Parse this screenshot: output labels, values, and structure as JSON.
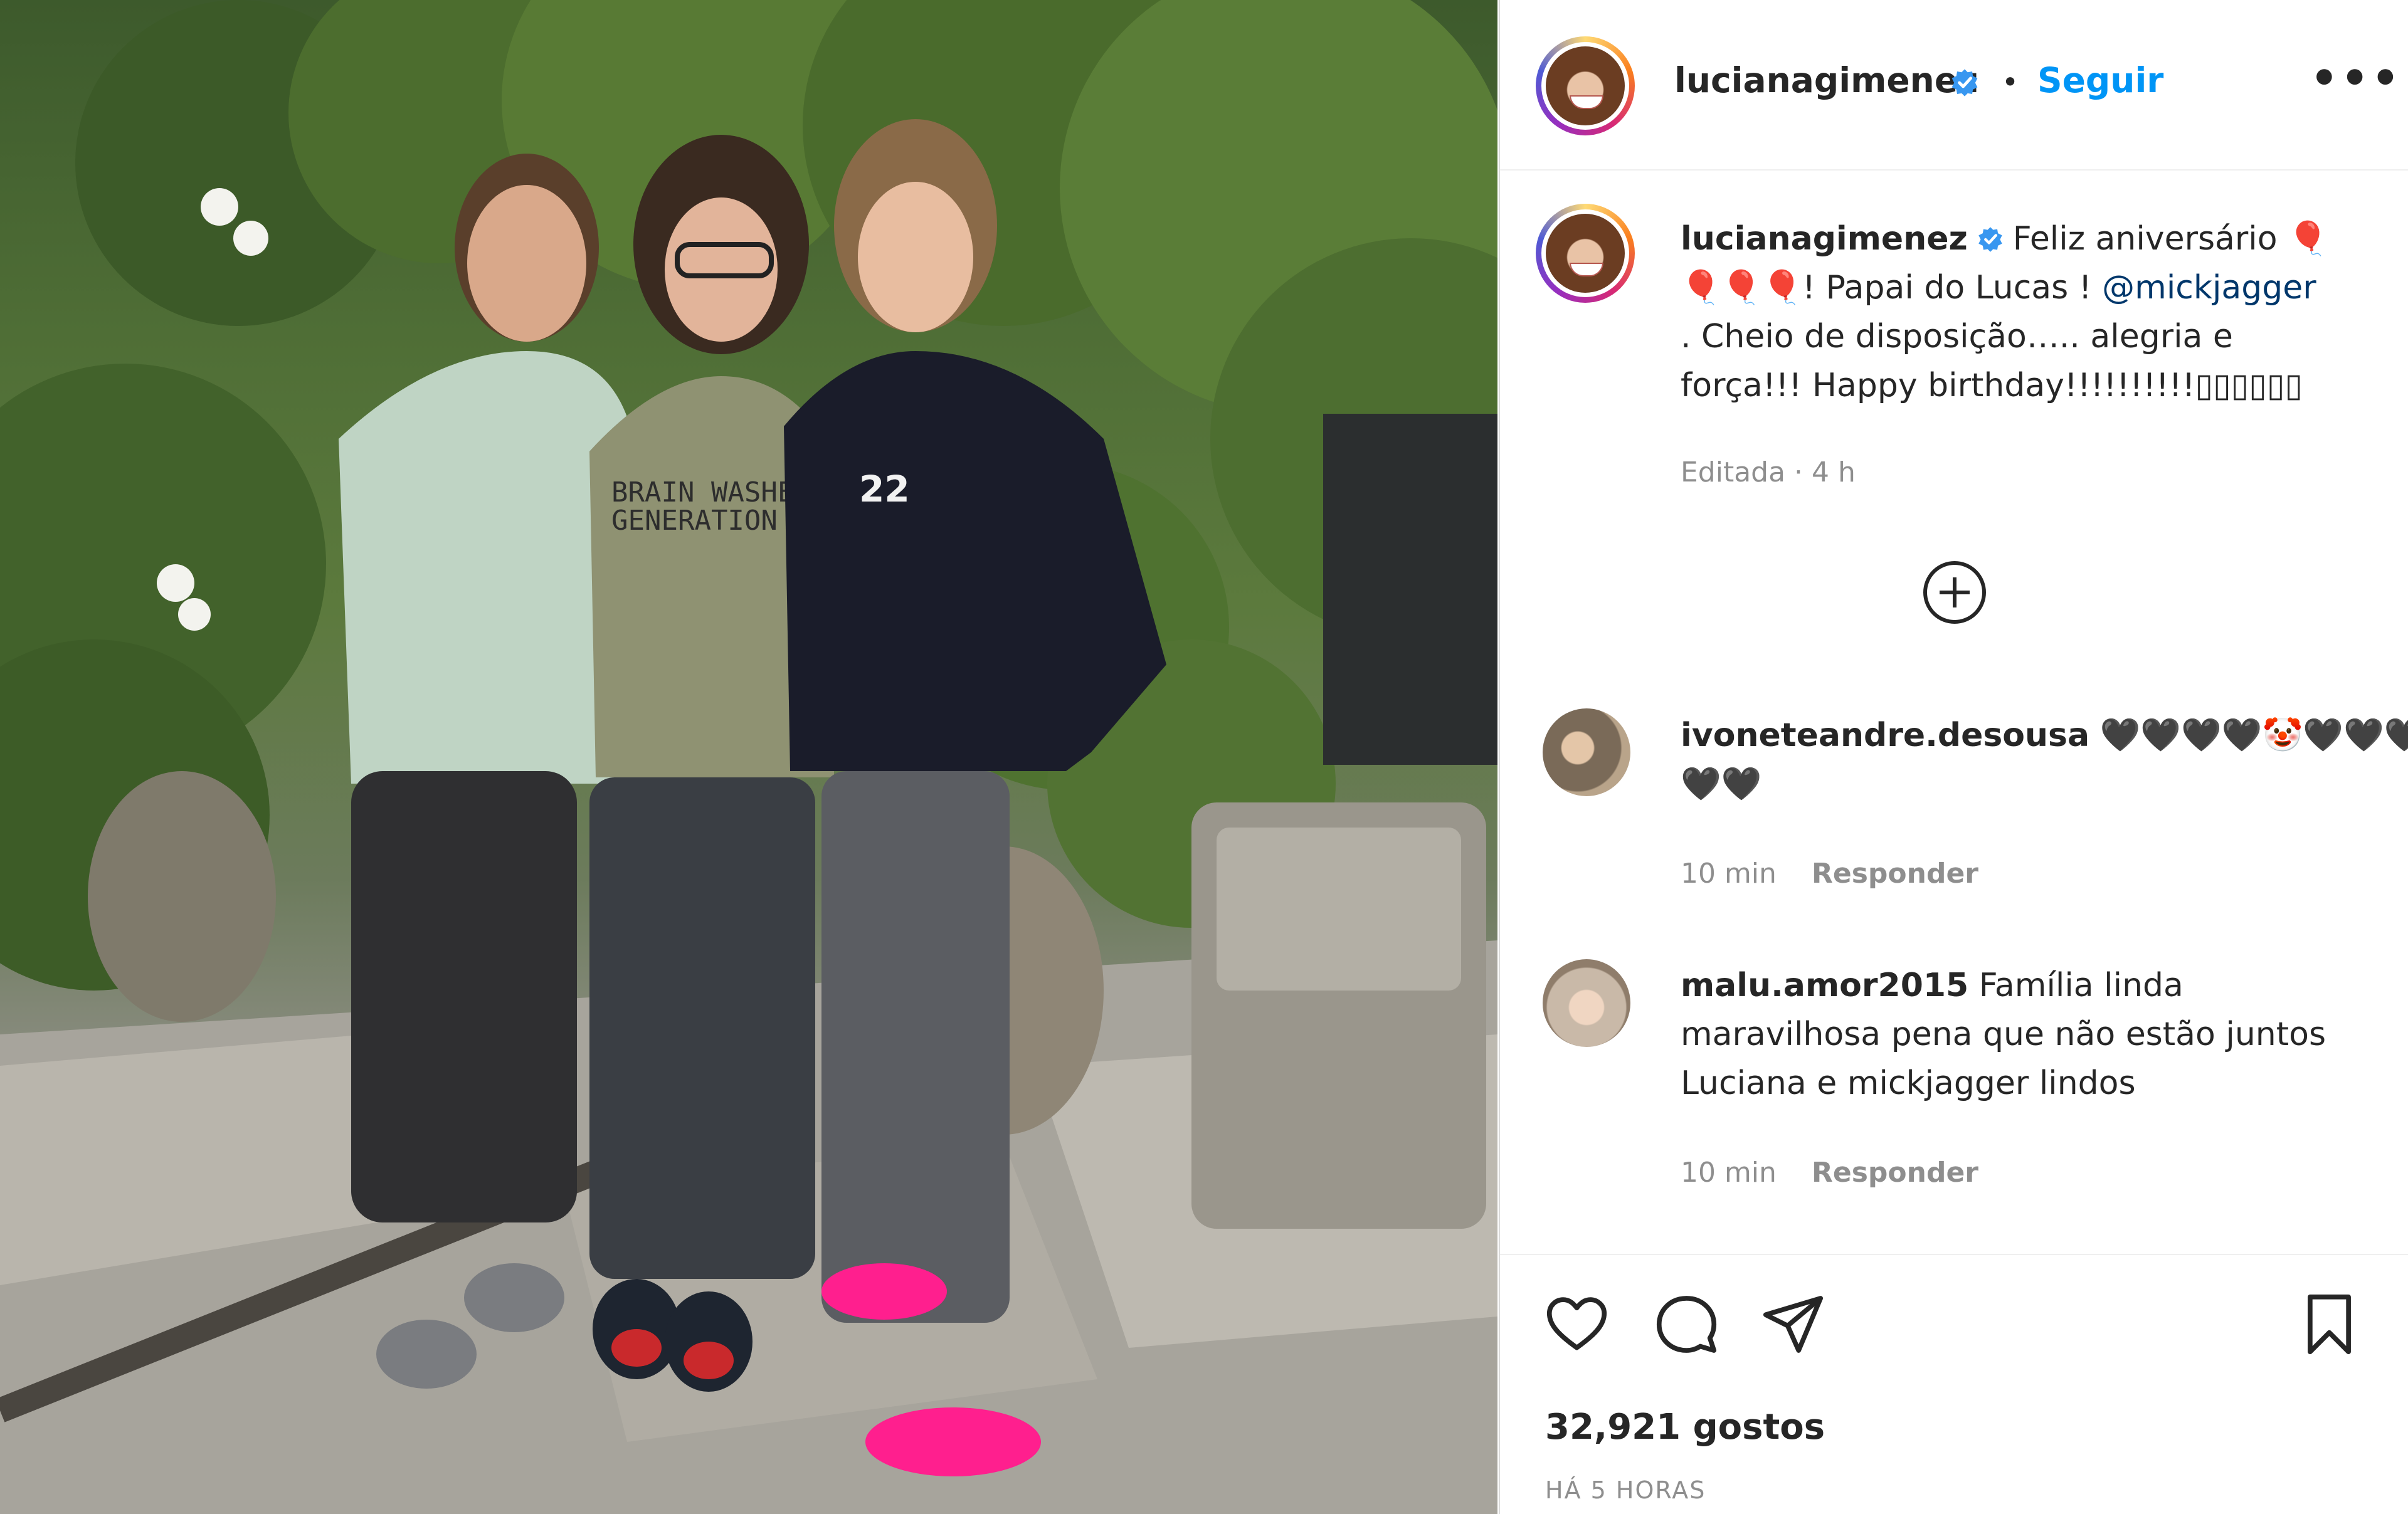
{
  "post": {
    "username": "lucianagimenez",
    "follow_label": "Seguir",
    "separator": "•",
    "more_label": "•••",
    "caption": {
      "username": "lucianagimenez",
      "line1": "Feliz aniversário 🎈",
      "line2a": "🎈🎈🎈! Papai do Lucas ! ",
      "mention": "@mickjagger",
      "line3": ". Cheio de disposição….. alegria e",
      "line4": "força!!! Happy birthday!!!!!!!!!!▯▯▯▯▯▯",
      "meta": "Editada · 4 h"
    },
    "comments": [
      {
        "username": "ivoneteandre.desousa",
        "text_line1": "🖤🖤🖤🖤🤡🖤🖤🖤",
        "text_line2": "🖤🖤",
        "time": "10 min",
        "reply_label": "Responder"
      },
      {
        "username": "malu.amor2015",
        "text_line1": "Família linda",
        "text_line2": "maravilhosa pena que não estão juntos",
        "text_line3": "Luciana e mickjagger lindos",
        "time": "10 min",
        "reply_label": "Responder"
      }
    ],
    "likes_text": "32,921 gostos",
    "posted_ago": "HÁ 5 HORAS"
  },
  "photo": {
    "shirt_text_line1": "BRAIN WASHED",
    "shirt_text_line2": "GENERATION",
    "hoodie_text": "22"
  },
  "colors": {
    "follow_blue": "#0095f6",
    "mention_blue": "#00376b",
    "verified_blue": "#3897f0",
    "text": "#262626",
    "muted": "#8e8e8e"
  },
  "icons": [
    "verified-badge-icon",
    "more-options-icon",
    "add-comment-icon",
    "heart-icon",
    "comment-icon",
    "share-icon",
    "save-icon"
  ]
}
